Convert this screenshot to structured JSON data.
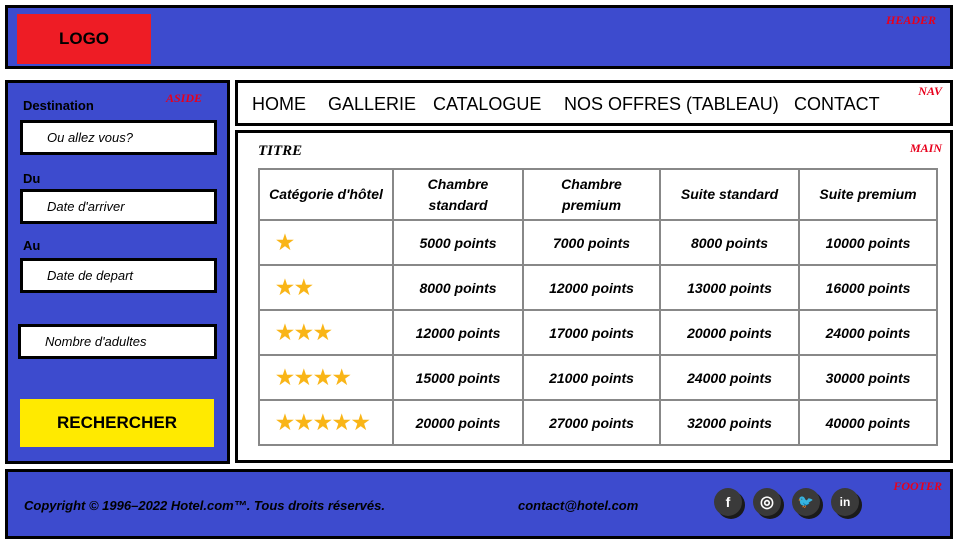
{
  "header": {
    "logo": "LOGO",
    "tag": "HEADER"
  },
  "aside": {
    "tag": "ASIDE",
    "destination_label": "Destination",
    "destination_placeholder": "Ou allez vous?",
    "from_label": "Du",
    "from_placeholder": "Date d'arriver",
    "to_label": "Au",
    "to_placeholder": "Date de depart",
    "adults_placeholder": "Nombre d'adultes",
    "search_button": "RECHERCHER"
  },
  "nav": {
    "tag": "NAV",
    "links": [
      "HOME",
      "GALLERIE",
      "CATALOGUE",
      "NOS OFFRES (TABLEAU)",
      "CONTACT"
    ]
  },
  "main": {
    "tag": "MAIN",
    "title": "TITRE",
    "table": {
      "headers": [
        "Catégorie d'hôtel",
        "Chambre standard",
        "Chambre premium",
        "Suite standard",
        "Suite premium"
      ],
      "rows": [
        {
          "stars": 1,
          "stars_text": "★",
          "values": [
            "5000 points",
            "7000 points",
            "8000 points",
            "10000 points"
          ]
        },
        {
          "stars": 2,
          "stars_text": "★★",
          "values": [
            "8000 points",
            "12000 points",
            "13000 points",
            "16000 points"
          ]
        },
        {
          "stars": 3,
          "stars_text": "★★★",
          "values": [
            "12000 points",
            "17000 points",
            "20000 points",
            "24000 points"
          ]
        },
        {
          "stars": 4,
          "stars_text": "★★★★",
          "values": [
            "15000 points",
            "21000 points",
            "24000 points",
            "30000 points"
          ]
        },
        {
          "stars": 5,
          "stars_text": "★★★★★",
          "values": [
            "20000 points",
            "27000 points",
            "32000 points",
            "40000 points"
          ]
        }
      ]
    }
  },
  "footer": {
    "tag": "FOOTER",
    "copyright": "Copyright © 1996–2022  Hotel.com™. Tous droits réservés.",
    "email": "contact@hotel.com",
    "social": [
      {
        "icon": "facebook-icon",
        "glyph": "f"
      },
      {
        "icon": "instagram-icon",
        "glyph": "◎"
      },
      {
        "icon": "twitter-icon",
        "glyph": "🐦"
      },
      {
        "icon": "linkedin-icon",
        "glyph": "in"
      }
    ]
  },
  "colors": {
    "panel": "#3d4bce",
    "logo": "#ee1c25",
    "button": "#ffea00",
    "star": "#f9b517",
    "tag": "#e8001c"
  }
}
